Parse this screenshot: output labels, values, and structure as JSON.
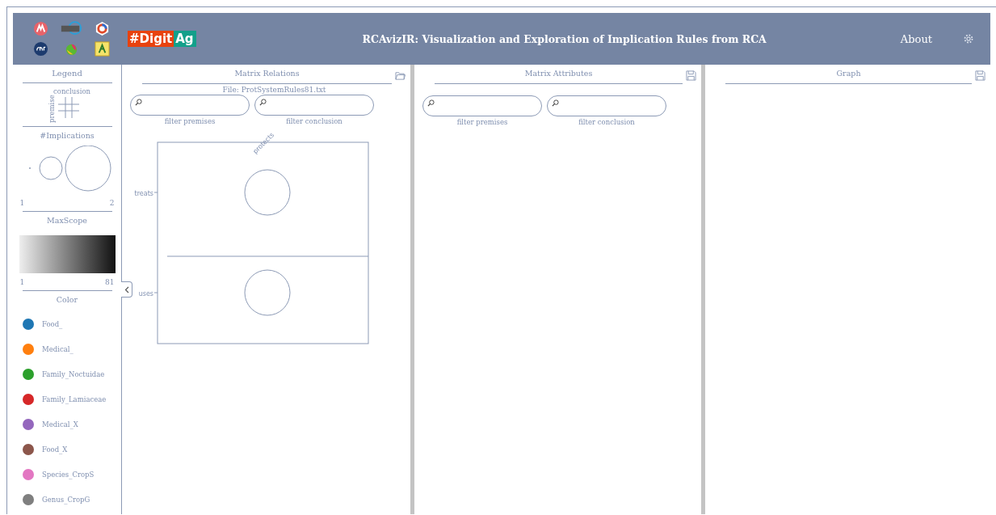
{
  "header": {
    "brand": {
      "part_1": "#Digit",
      "part_2": "Ag"
    },
    "title": "RCAvizIR: Visualization and Exploration of Implication Rules from RCA",
    "about": "About"
  },
  "legend": {
    "title": "Legend",
    "matrix_key": {
      "conclusion": "conclusion",
      "premise": "premise"
    },
    "implications": {
      "title": "#Implications",
      "min": "1",
      "max": "2"
    },
    "max_scope": {
      "title": "MaxScope",
      "min": "1",
      "max": "81"
    },
    "color": {
      "title": "Color",
      "items": [
        {
          "label": "Food_",
          "color": "#1f77b4"
        },
        {
          "label": "Medical_",
          "color": "#ff7f0e"
        },
        {
          "label": "Family_Noctuidae",
          "color": "#2ca02c"
        },
        {
          "label": "Family_Lamiaceae",
          "color": "#d62728"
        },
        {
          "label": "Medical_X",
          "color": "#9467bd"
        },
        {
          "label": "Food_X",
          "color": "#8c564b"
        },
        {
          "label": "Species_CropS",
          "color": "#e377c2"
        },
        {
          "label": "Genus_CropG",
          "color": "#7f7f7f"
        }
      ]
    }
  },
  "matrix_relations": {
    "title": "Matrix Relations",
    "file": "File: ProtSystemRules81.txt",
    "filters": [
      {
        "label": "filter premises"
      },
      {
        "label": "filter conclusion"
      }
    ],
    "columns": [
      "protects"
    ],
    "rows": [
      "treats",
      "uses"
    ]
  },
  "matrix_attributes": {
    "title": "Matrix Attributes",
    "filters": [
      {
        "label": "filter premises"
      },
      {
        "label": "filter conclusion"
      }
    ]
  },
  "graph": {
    "title": "Graph"
  }
}
